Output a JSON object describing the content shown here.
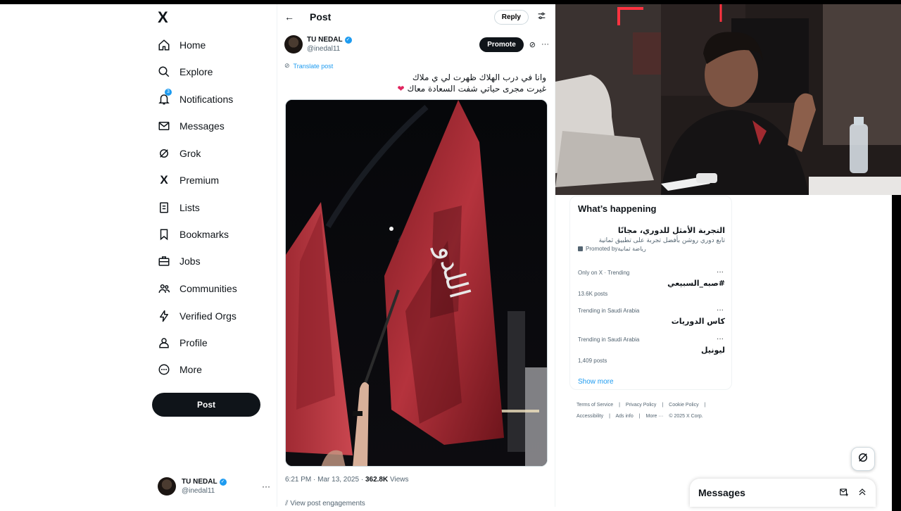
{
  "nav": {
    "logo": "X",
    "items": [
      {
        "label": "Home",
        "icon": "home-icon"
      },
      {
        "label": "Explore",
        "icon": "search-icon"
      },
      {
        "label": "Notifications",
        "icon": "bell-icon",
        "badge": "3"
      },
      {
        "label": "Messages",
        "icon": "mail-icon"
      },
      {
        "label": "Grok",
        "icon": "grok-icon"
      },
      {
        "label": "Premium",
        "icon": "x-icon"
      },
      {
        "label": "Lists",
        "icon": "list-icon"
      },
      {
        "label": "Bookmarks",
        "icon": "bookmark-icon"
      },
      {
        "label": "Jobs",
        "icon": "briefcase-icon"
      },
      {
        "label": "Communities",
        "icon": "people-icon"
      },
      {
        "label": "Verified Orgs",
        "icon": "lightning-icon"
      },
      {
        "label": "Profile",
        "icon": "person-icon"
      },
      {
        "label": "More",
        "icon": "more-circle-icon"
      }
    ],
    "post_button": "Post",
    "account": {
      "name": "TU NEDAL",
      "handle": "@inedal11"
    }
  },
  "post": {
    "header_title": "Post",
    "reply_label": "Reply",
    "author": {
      "name": "TU NEDAL",
      "handle": "@inedal11"
    },
    "promote_label": "Promote",
    "translate_label": "Translate post",
    "text_line1": "وانا في درب الهلاك ظهرت لي ي ملاك",
    "text_line2": "غيرت مجرى حياتي شفت السعادة معاك",
    "heart": "❤",
    "timestamp": "6:21 PM · Mar 13, 2025 · ",
    "views_count": "362.8K",
    "views_label": " Views",
    "engagements": "View post engagements"
  },
  "whats_happening": {
    "title": "What’s happening",
    "promo": {
      "title": "التجربة الأمثل للدوري، مجانًا",
      "subtitle": "تابع دوري روشن بأفضل تجربة على تطبيق ثمانية",
      "promoted_by": "Promoted by ",
      "advertiser": "رياضة ثمانية"
    },
    "trends": [
      {
        "context": "Only on X · Trending",
        "name": "#صبه_السبيعي",
        "count": "13.6K posts"
      },
      {
        "context": "Trending in Saudi Arabia",
        "name": "كاس الدوريات",
        "count": ""
      },
      {
        "context": "Trending in Saudi Arabia",
        "name": "ليونيل",
        "count": "1,409 posts"
      }
    ],
    "show_more": "Show more"
  },
  "footer": {
    "links": [
      "Terms of Service",
      "|",
      "Privacy Policy",
      "|",
      "Cookie Policy",
      "|"
    ],
    "links2": [
      "Accessibility",
      "|",
      "Ads info",
      "|",
      "More ···",
      "© 2025 X Corp."
    ]
  },
  "messages_drawer": {
    "title": "Messages"
  },
  "colors": {
    "accent": "#1d9bf0",
    "text": "#0f1419",
    "muted": "#536471"
  }
}
